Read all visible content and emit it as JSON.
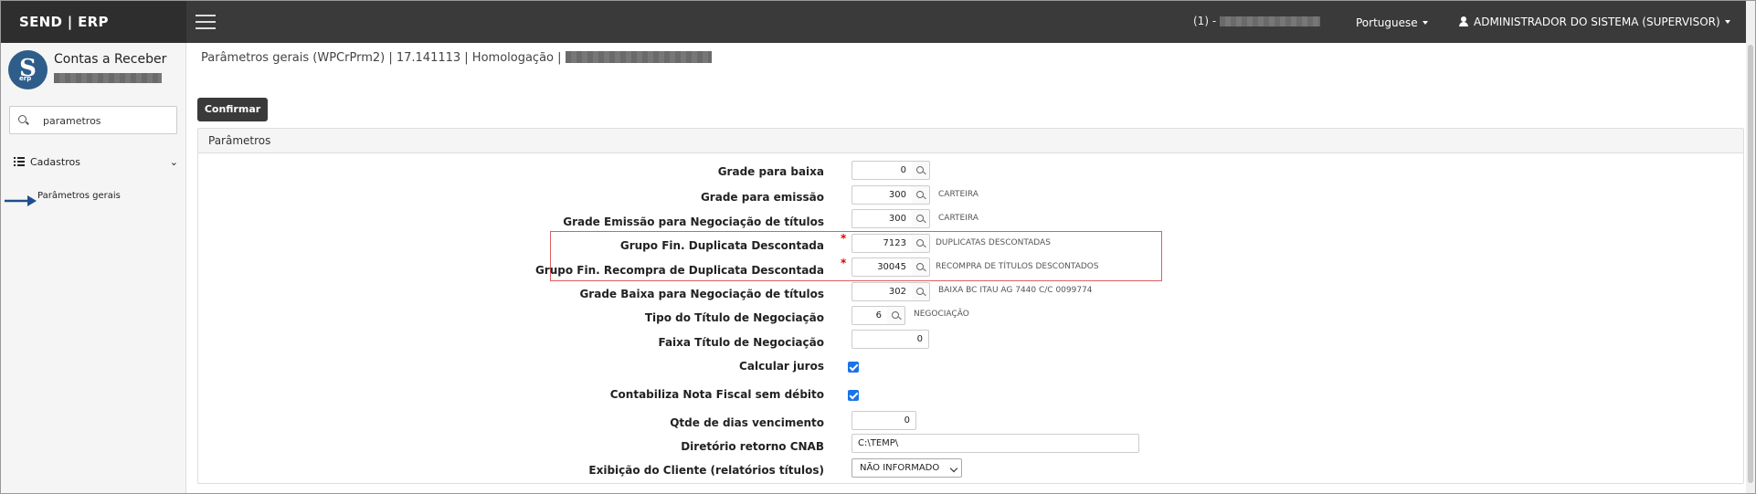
{
  "header": {
    "brand": "SEND | ERP",
    "company_prefix": "(1) -",
    "language": "Portuguese",
    "user": "ADMINISTRADOR DO SISTEMA (SUPERVISOR)"
  },
  "sidebar": {
    "module_title": "Contas a Receber",
    "logo_letter": "S",
    "logo_sub": "erp",
    "search_value": "parametros",
    "group_label": "Cadastros",
    "item_label": "Parâmetros gerais"
  },
  "main": {
    "breadcrumb": "Parâmetros gerais (WPCrPrm2) | 17.141113 | Homologação |",
    "confirm_label": "Confirmar",
    "panel_title": "Parâmetros"
  },
  "rows": [
    {
      "label": "Grade para baixa",
      "value": "0",
      "desc": ""
    },
    {
      "label": "Grade para emissão",
      "value": "300",
      "desc": "CARTEIRA"
    },
    {
      "label": "Grade Emissão para Negociação de títulos",
      "value": "300",
      "desc": "CARTEIRA"
    },
    {
      "label": "Grupo Fin. Duplicata Descontada",
      "value": "7123",
      "desc": "DUPLICATAS DESCONTADAS"
    },
    {
      "label": "Grupo Fin. Recompra de Duplicata Descontada",
      "value": "30045",
      "desc": "RECOMPRA DE TÍTULOS DESCONTADOS"
    },
    {
      "label": "Grade Baixa para Negociação de títulos",
      "value": "302",
      "desc": "BAIXA BC ITAU AG 7440 C/C 0099774"
    },
    {
      "label": "Tipo do Título de Negociação",
      "value": "6",
      "desc": "NEGOCIAÇÃO"
    },
    {
      "label": "Faixa Título de Negociação",
      "value": "0"
    },
    {
      "label": "Calcular juros",
      "checked": true
    },
    {
      "label": "Contabiliza Nota Fiscal sem débito",
      "checked": true
    },
    {
      "label": "Qtde de dias vencimento",
      "value": "0"
    },
    {
      "label": "Diretório retorno CNAB",
      "value": "C:\\TEMP\\"
    },
    {
      "label": "Exibição do Cliente (relatórios títulos)",
      "value": "NÃO INFORMADO"
    }
  ],
  "required_mark": "*"
}
